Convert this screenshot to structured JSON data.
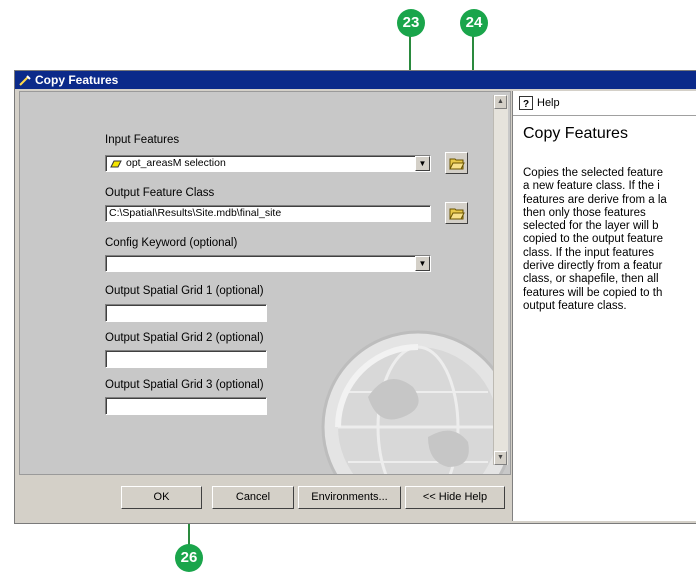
{
  "callouts": {
    "c23": "23",
    "c24": "24",
    "c26": "26"
  },
  "window": {
    "title": "Copy Features"
  },
  "form": {
    "input_features_label": "Input Features",
    "input_features_value": "opt_areasM selection",
    "output_class_label": "Output Feature Class",
    "output_class_value": "C:\\Spatial\\Results\\Site.mdb\\final_site",
    "config_label": "Config Keyword (optional)",
    "config_value": "",
    "grid1_label": "Output Spatial Grid 1 (optional)",
    "grid2_label": "Output Spatial Grid 2 (optional)",
    "grid3_label": "Output Spatial Grid 3 (optional)"
  },
  "buttons": {
    "ok": "OK",
    "cancel": "Cancel",
    "environments": "Environments...",
    "hide_help": "<< Hide Help"
  },
  "help": {
    "tab_label": "Help",
    "title": "Copy Features",
    "body": "Copies the selected feature\na new feature class. If the i\nfeatures are derive from a la\nthen only those features\nselected for the layer will b\ncopied to the output feature\nclass. If the input features\nderive directly from a featur\nclass, or shapefile, then all\nfeatures will be copied to th\noutput feature class."
  },
  "colors": {
    "callout": "#1aa54b",
    "titlebar": "#0b2a8a",
    "dialog": "#d4d0c8"
  }
}
